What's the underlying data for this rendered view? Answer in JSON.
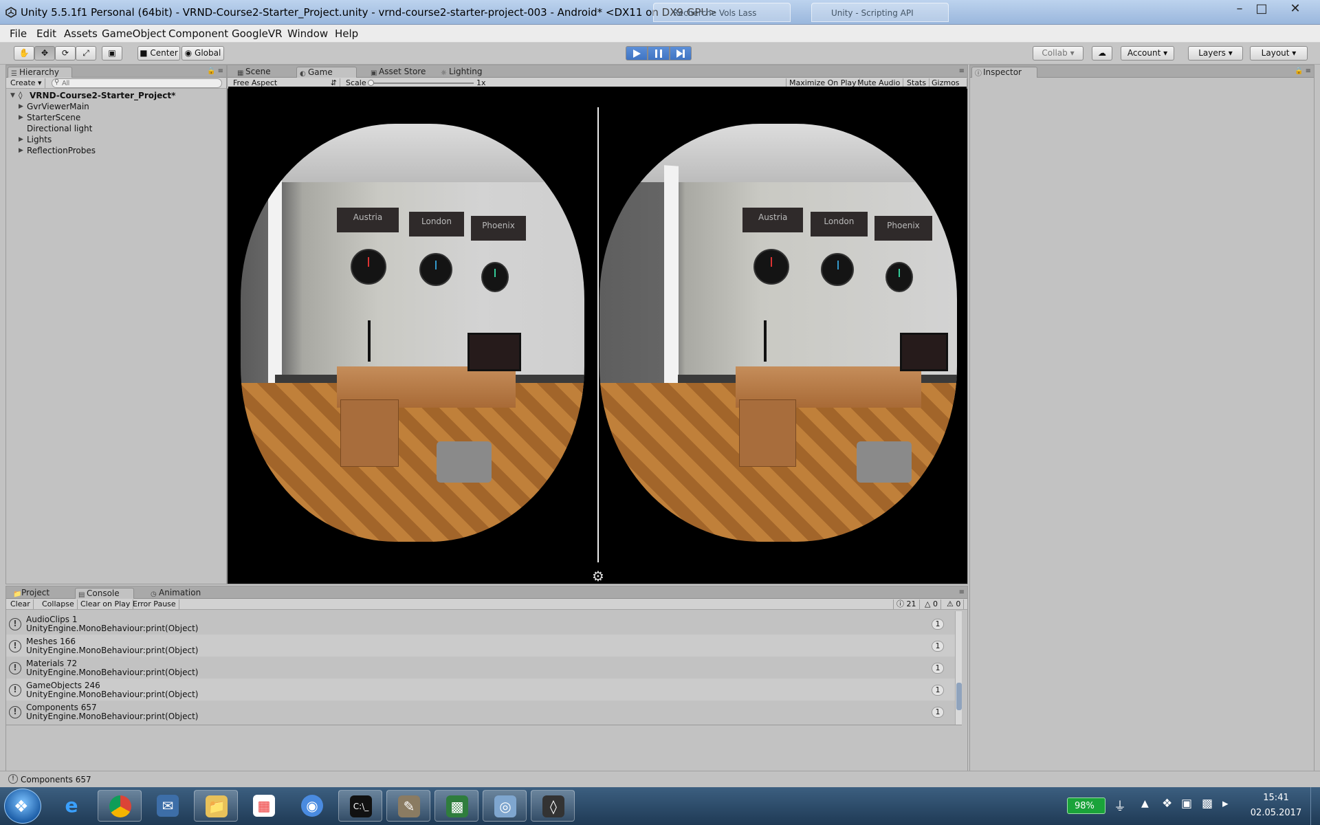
{
  "window": {
    "title": "Unity 5.5.1f1 Personal (64bit) - VRND-Course2-Starter_Project.unity - vrnd-course2-starter-project-003 - Android* <DX11 on DX9 GPU>",
    "background_tabs": [
      "Recherche Vols Lass",
      "Unity - Scripting API"
    ]
  },
  "menu": [
    "File",
    "Edit",
    "Assets",
    "GameObject",
    "Component",
    "GoogleVR",
    "Window",
    "Help"
  ],
  "toolbar": {
    "pivot": "Center",
    "space": "Global",
    "collab": "Collab",
    "account": "Account",
    "layers": "Layers",
    "layout": "Layout"
  },
  "hierarchy": {
    "tab": "Hierarchy",
    "create": "Create",
    "search_placeholder": "All",
    "scene": "VRND-Course2-Starter_Project*",
    "items": [
      {
        "label": "GvrViewerMain",
        "expandable": true
      },
      {
        "label": "StarterScene",
        "expandable": true
      },
      {
        "label": "Directional light",
        "expandable": false
      },
      {
        "label": "Lights",
        "expandable": true
      },
      {
        "label": "ReflectionProbes",
        "expandable": true
      }
    ]
  },
  "center_tabs": [
    "Scene",
    "Game",
    "Asset Store",
    "Lighting"
  ],
  "game": {
    "aspect": "Free Aspect",
    "scale_label": "Scale",
    "scale_value": "1x",
    "options": [
      "Maximize On Play",
      "Mute Audio",
      "Stats",
      "Gizmos"
    ],
    "signs": [
      "Austria",
      "London",
      "Phoenix"
    ]
  },
  "inspector": {
    "tab": "Inspector"
  },
  "bottom_tabs": [
    "Project",
    "Console",
    "Animation"
  ],
  "console": {
    "buttons": [
      "Clear",
      "Collapse",
      "Clear on Play",
      "Error Pause"
    ],
    "counts": {
      "logs": "21",
      "warnings": "0",
      "errors": "0"
    },
    "rows": [
      {
        "message": "AudioClips 1",
        "trace": "UnityEngine.MonoBehaviour:print(Object)",
        "count": "1"
      },
      {
        "message": "Meshes 166",
        "trace": "UnityEngine.MonoBehaviour:print(Object)",
        "count": "1"
      },
      {
        "message": "Materials 72",
        "trace": "UnityEngine.MonoBehaviour:print(Object)",
        "count": "1"
      },
      {
        "message": "GameObjects 246",
        "trace": "UnityEngine.MonoBehaviour:print(Object)",
        "count": "1"
      },
      {
        "message": "Components 657",
        "trace": "UnityEngine.MonoBehaviour:print(Object)",
        "count": "1"
      }
    ]
  },
  "status": {
    "message": "Components 657"
  },
  "taskbar": {
    "battery": "98%",
    "time": "15:41",
    "date": "02.05.2017"
  },
  "colors": {
    "unity_play_blue": "#3f74c4",
    "panel_gray": "#c2c2c2",
    "taskbar_blue": "#1f3a55"
  }
}
